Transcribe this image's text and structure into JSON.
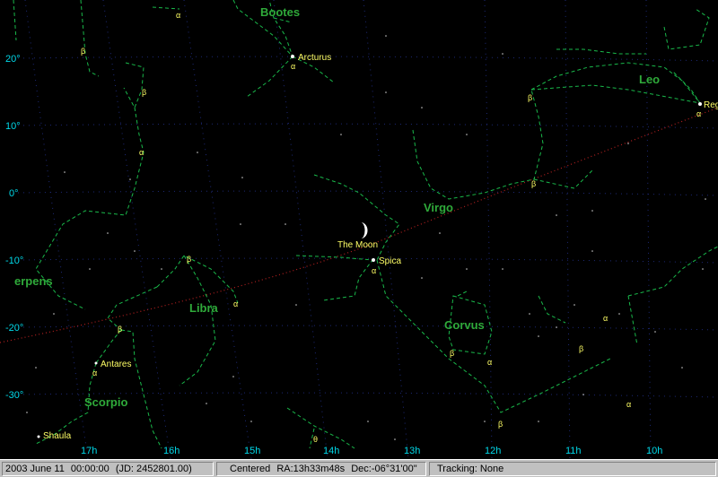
{
  "sky": {
    "colors": {
      "background": "#000000",
      "grid": "#1e2a78",
      "constellation": "#19b84a",
      "constellation_label": "#2faa3a",
      "star_label": "#ffff66",
      "moon_label": "#ffff66",
      "greek": "#ffff66",
      "ecliptic": "#b32020",
      "axis_label": "#00d8e8"
    },
    "dec_labels": [
      "20°",
      "10°",
      "0°",
      "-10°",
      "-20°",
      "-30°"
    ],
    "ra_labels": [
      "17h",
      "16h",
      "15h",
      "14h",
      "13h",
      "12h",
      "11h",
      "10h"
    ],
    "constellations": [
      "Bootes",
      "Leo",
      "Virgo",
      "erpens",
      "Libra",
      "Corvus",
      "Scorpio"
    ],
    "named_stars": [
      "Arcturus",
      "Regulus",
      "Spica",
      "Antares",
      "Shaula"
    ],
    "regulus_visible": "Reg",
    "moon_label": "The Moon",
    "greek": {
      "alpha": "α",
      "beta": "β",
      "theta": "θ"
    }
  },
  "status": {
    "date": "2003 June 11",
    "time": "00:00:00",
    "jd": "(JD: 2452801.00)",
    "centered_label": "Centered",
    "ra": "RA:13h33m48s",
    "dec": "Dec:-06°31'00\"",
    "tracking": "Tracking: None"
  }
}
